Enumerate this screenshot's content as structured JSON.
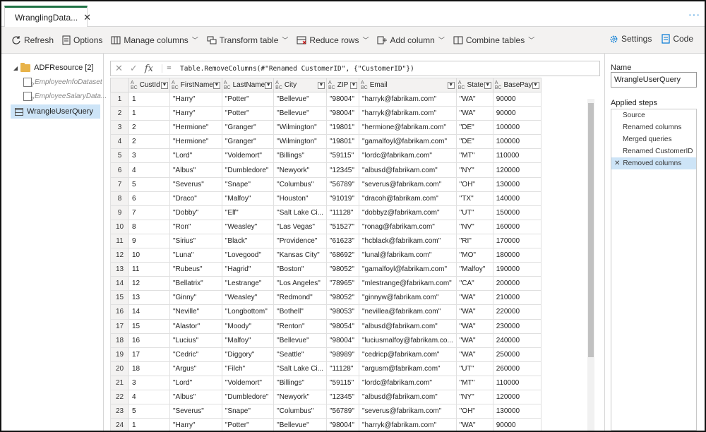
{
  "tab": {
    "title": "WranglingData..."
  },
  "toolbar": {
    "refresh": "Refresh",
    "options": "Options",
    "manage_columns": "Manage columns",
    "transform_table": "Transform table",
    "reduce_rows": "Reduce rows",
    "add_column": "Add column",
    "combine_tables": "Combine tables",
    "settings": "Settings",
    "code": "Code"
  },
  "tree": {
    "root": "ADFResource",
    "root_count": "[2]",
    "items": [
      "EmployeeInfoDataset",
      "EmployeeSalaryData..."
    ],
    "selected": "WrangleUserQuery"
  },
  "formula": {
    "eq": "=",
    "text": "Table.RemoveColumns(#\"Renamed CustomerID\", {\"CustomerID\"})"
  },
  "table": {
    "columns": [
      "CustId",
      "FirstName",
      "LastName",
      "City",
      "ZIP",
      "Email",
      "State",
      "BasePay"
    ],
    "rows": [
      [
        "1",
        "1",
        "\"Harry\"",
        "\"Potter\"",
        "\"Bellevue\"",
        "\"98004\"",
        "\"harryk@fabrikam.com\"",
        "\"WA\"",
        "90000"
      ],
      [
        "2",
        "1",
        "\"Harry\"",
        "\"Potter\"",
        "\"Bellevue\"",
        "\"98004\"",
        "\"harryk@fabrikam.com\"",
        "\"WA\"",
        "90000"
      ],
      [
        "3",
        "2",
        "\"Hermione\"",
        "\"Granger\"",
        "\"Wilmington\"",
        "\"19801\"",
        "\"hermione@fabrikam.com\"",
        "\"DE\"",
        "100000"
      ],
      [
        "4",
        "2",
        "\"Hermione\"",
        "\"Granger\"",
        "\"Wilmington\"",
        "\"19801\"",
        "\"gamalfoyl@fabrikam.com\"",
        "\"DE\"",
        "100000"
      ],
      [
        "5",
        "3",
        "\"Lord\"",
        "\"Voldemort\"",
        "\"Billings\"",
        "\"59115\"",
        "\"lordc@fabrikam.com\"",
        "\"MT\"",
        "110000"
      ],
      [
        "6",
        "4",
        "\"Albus\"",
        "\"Dumbledore\"",
        "\"Newyork\"",
        "\"12345\"",
        "\"albusd@fabrikam.com\"",
        "\"NY\"",
        "120000"
      ],
      [
        "7",
        "5",
        "\"Severus\"",
        "\"Snape\"",
        "\"Columbus\"",
        "\"56789\"",
        "\"severus@fabrikam.com\"",
        "\"OH\"",
        "130000"
      ],
      [
        "8",
        "6",
        "\"Draco\"",
        "\"Malfoy\"",
        "\"Houston\"",
        "\"91019\"",
        "\"dracoh@fabrikam.com\"",
        "\"TX\"",
        "140000"
      ],
      [
        "9",
        "7",
        "\"Dobby\"",
        "\"Elf\"",
        "\"Salt Lake Ci...",
        "\"11128\"",
        "\"dobbyz@fabrikam.com\"",
        "\"UT\"",
        "150000"
      ],
      [
        "10",
        "8",
        "\"Ron\"",
        "\"Weasley\"",
        "\"Las Vegas\"",
        "\"51527\"",
        "\"ronag@fabrikam.com\"",
        "\"NV\"",
        "160000"
      ],
      [
        "11",
        "9",
        "\"Sirius\"",
        "\"Black\"",
        "\"Providence\"",
        "\"61623\"",
        "\"hcblack@fabrikam.com\"",
        "\"RI\"",
        "170000"
      ],
      [
        "12",
        "10",
        "\"Luna\"",
        "\"Lovegood\"",
        "\"Kansas City\"",
        "\"68692\"",
        "\"lunal@fabrikam.com\"",
        "\"MO\"",
        "180000"
      ],
      [
        "13",
        "11",
        "\"Rubeus\"",
        "\"Hagrid\"",
        "\"Boston\"",
        "\"98052\"",
        "\"gamalfoyl@fabrikam.com\"",
        "\"Malfoy\"",
        "190000"
      ],
      [
        "14",
        "12",
        "\"Bellatrix\"",
        "\"Lestrange\"",
        "\"Los Angeles\"",
        "\"78965\"",
        "\"mlestrange@fabrikam.com\"",
        "\"CA\"",
        "200000"
      ],
      [
        "15",
        "13",
        "\"Ginny\"",
        "\"Weasley\"",
        "\"Redmond\"",
        "\"98052\"",
        "\"ginnyw@fabrikam.com\"",
        "\"WA\"",
        "210000"
      ],
      [
        "16",
        "14",
        "\"Neville\"",
        "\"Longbottom\"",
        "\"Bothell\"",
        "\"98053\"",
        "\"nevillea@fabrikam.com\"",
        "\"WA\"",
        "220000"
      ],
      [
        "17",
        "15",
        "\"Alastor\"",
        "\"Moody\"",
        "\"Renton\"",
        "\"98054\"",
        "\"albusd@fabrikam.com\"",
        "\"WA\"",
        "230000"
      ],
      [
        "18",
        "16",
        "\"Lucius\"",
        "\"Malfoy\"",
        "\"Bellevue\"",
        "\"98004\"",
        "\"luciusmalfoy@fabrikam.co...",
        "\"WA\"",
        "240000"
      ],
      [
        "19",
        "17",
        "\"Cedric\"",
        "\"Diggory\"",
        "\"Seattle\"",
        "\"98989\"",
        "\"cedricp@fabrikam.com\"",
        "\"WA\"",
        "250000"
      ],
      [
        "20",
        "18",
        "\"Argus\"",
        "\"Filch\"",
        "\"Salt Lake Ci...",
        "\"11128\"",
        "\"argusm@fabrikam.com\"",
        "\"UT\"",
        "260000"
      ],
      [
        "21",
        "3",
        "\"Lord\"",
        "\"Voldemort\"",
        "\"Billings\"",
        "\"59115\"",
        "\"lordc@fabrikam.com\"",
        "\"MT\"",
        "110000"
      ],
      [
        "22",
        "4",
        "\"Albus\"",
        "\"Dumbledore\"",
        "\"Newyork\"",
        "\"12345\"",
        "\"albusd@fabrikam.com\"",
        "\"NY\"",
        "120000"
      ],
      [
        "23",
        "5",
        "\"Severus\"",
        "\"Snape\"",
        "\"Columbus\"",
        "\"56789\"",
        "\"severus@fabrikam.com\"",
        "\"OH\"",
        "130000"
      ],
      [
        "24",
        "1",
        "\"Harry\"",
        "\"Potter\"",
        "\"Bellevue\"",
        "\"98004\"",
        "\"harryk@fabrikam.com\"",
        "\"WA\"",
        "90000"
      ]
    ]
  },
  "right": {
    "name_label": "Name",
    "name_value": "WrangleUserQuery",
    "steps_label": "Applied steps",
    "steps": [
      "Source",
      "Renamed columns",
      "Merged queries",
      "Renamed CustomerID",
      "Removed columns"
    ]
  },
  "colors": {
    "accent": "#217346",
    "selection": "#cde4f7",
    "link": "#0078d4"
  }
}
